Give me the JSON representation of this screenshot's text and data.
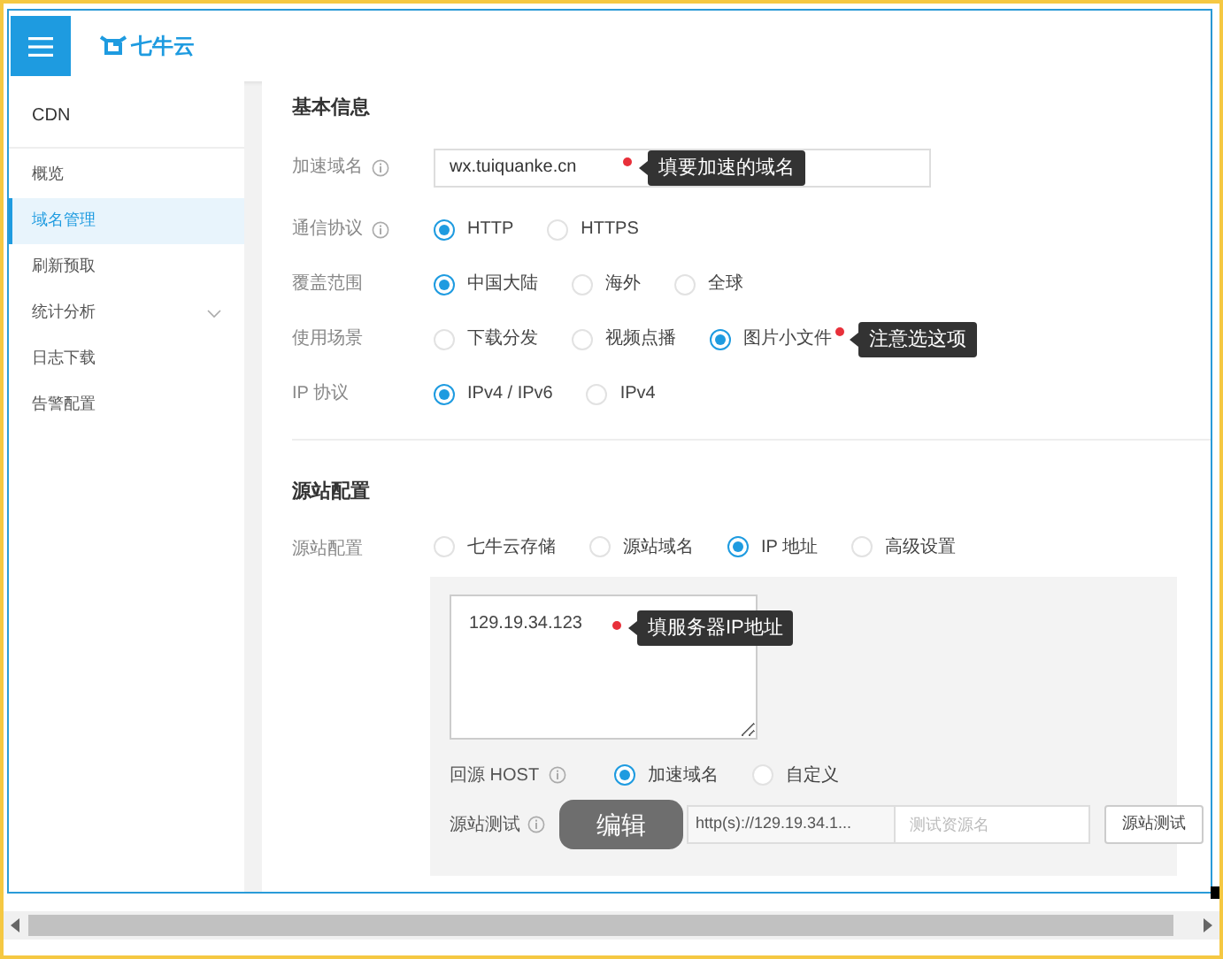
{
  "header": {
    "logo_text": "七牛云"
  },
  "sidebar": {
    "title": "CDN",
    "items": [
      {
        "label": "概览",
        "selected": false,
        "expandable": false
      },
      {
        "label": "域名管理",
        "selected": true,
        "expandable": false
      },
      {
        "label": "刷新预取",
        "selected": false,
        "expandable": false
      },
      {
        "label": "统计分析",
        "selected": false,
        "expandable": true
      },
      {
        "label": "日志下载",
        "selected": false,
        "expandable": false
      },
      {
        "label": "告警配置",
        "selected": false,
        "expandable": false
      }
    ]
  },
  "basic": {
    "title": "基本信息",
    "domain": {
      "label": "加速域名",
      "value": "wx.tuiquanke.cn",
      "tip": "填要加速的域名"
    },
    "radio_rows": [
      {
        "label": "通信协议",
        "info": true,
        "options": [
          {
            "label": "HTTP",
            "selected": true
          },
          {
            "label": "HTTPS",
            "selected": false
          }
        ]
      },
      {
        "label": "覆盖范围",
        "info": false,
        "options": [
          {
            "label": "中国大陆",
            "selected": true
          },
          {
            "label": "海外",
            "selected": false
          },
          {
            "label": "全球",
            "selected": false
          }
        ]
      },
      {
        "label": "使用场景",
        "info": false,
        "options": [
          {
            "label": "下载分发",
            "selected": false
          },
          {
            "label": "视频点播",
            "selected": false
          },
          {
            "label": "图片小文件",
            "selected": true,
            "tip": "注意选这项"
          }
        ]
      },
      {
        "label": "IP 协议",
        "info": false,
        "options": [
          {
            "label": "IPv4 / IPv6",
            "selected": true
          },
          {
            "label": "IPv4",
            "selected": false
          }
        ]
      }
    ]
  },
  "origin": {
    "title": "源站配置",
    "config": {
      "label": "源站配置",
      "options": [
        {
          "label": "七牛云存储",
          "selected": false
        },
        {
          "label": "源站域名",
          "selected": false
        },
        {
          "label": "IP 地址",
          "selected": true
        },
        {
          "label": "高级设置",
          "selected": false
        }
      ]
    },
    "ip_list": {
      "value": "129.19.34.123",
      "tip": "填服务器IP地址"
    },
    "host": {
      "label": "回源 HOST",
      "options": [
        {
          "label": "加速域名",
          "selected": true
        },
        {
          "label": "自定义",
          "selected": false
        }
      ]
    },
    "test": {
      "label": "源站测试",
      "prefix": "http(s)://129.19.34.1...",
      "placeholder": "测试资源名",
      "button": "源站测试"
    }
  },
  "overlay_button": "编辑"
}
